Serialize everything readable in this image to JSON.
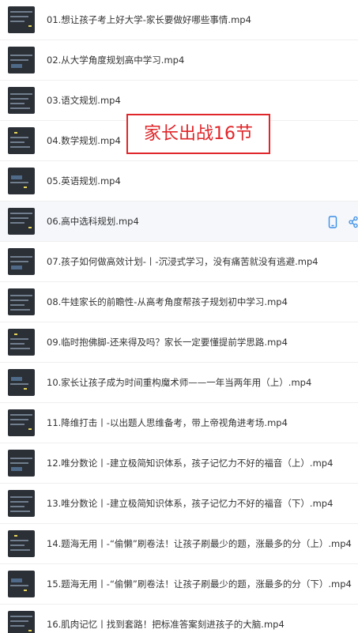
{
  "files": [
    {
      "name": "01.想让孩子考上好大学-家长要做好哪些事情.mp4"
    },
    {
      "name": "02.从大学角度规划高中学习.mp4"
    },
    {
      "name": "03.语文规划.mp4"
    },
    {
      "name": "04.数学规划.mp4"
    },
    {
      "name": "05.英语规划.mp4"
    },
    {
      "name": "06.高中选科规划.mp4"
    },
    {
      "name": "07.孩子如何做高效计划-丨-沉浸式学习，没有痛苦就没有逃避.mp4"
    },
    {
      "name": "08.牛娃家长的前瞻性-从高考角度帮孩子规划初中学习.mp4"
    },
    {
      "name": "09.临时抱佛脚-还来得及吗？家长一定要懂提前学思路.mp4"
    },
    {
      "name": "10.家长让孩子成为时间重构魔术师——一年当两年用（上）.mp4"
    },
    {
      "name": "11.降维打击丨-以出题人思维备考，带上帝视角进考场.mp4"
    },
    {
      "name": "12.唯分数论丨-建立极简知识体系，孩子记忆力不好的福音（上）.mp4"
    },
    {
      "name": "13.唯分数论丨-建立极简知识体系，孩子记忆力不好的福音（下）.mp4"
    },
    {
      "name": "14.题海无用丨-“偷懒”刷卷法！让孩子刷最少的题，涨最多的分（上）.mp4"
    },
    {
      "name": "15.题海无用丨-“偷懒”刷卷法！让孩子刷最少的题，涨最多的分（下）.mp4"
    },
    {
      "name": "16.肌肉记忆丨找到套路！把标准答案刻进孩子的大脑.mp4"
    }
  ],
  "hovered_row_index": 5,
  "row_actions": {
    "phone_icon": "phone-icon",
    "share_icon": "share-icon"
  },
  "overlay": {
    "text": "家长出战16节"
  },
  "colors": {
    "accent": "#3a8ee6",
    "stamp": "#e0262a"
  }
}
